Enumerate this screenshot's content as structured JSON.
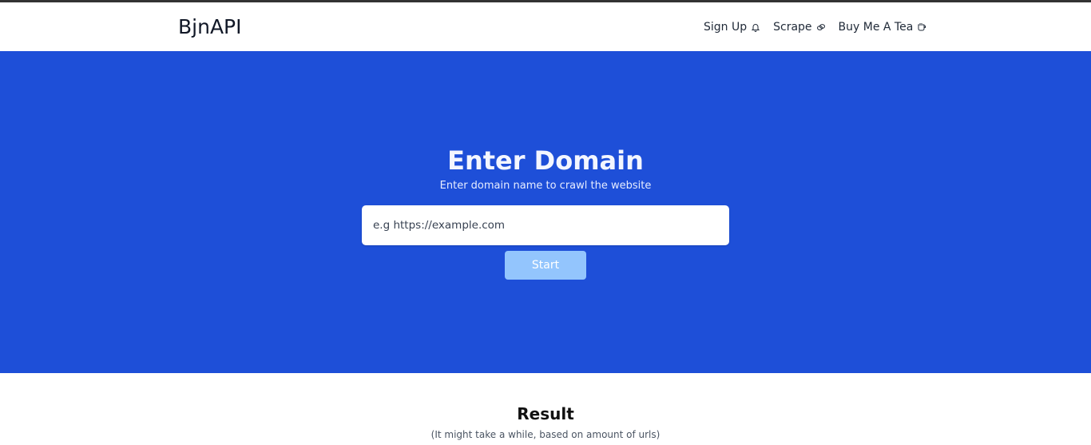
{
  "navbar": {
    "brand": "BjnAPI",
    "items": [
      {
        "label": "Sign Up",
        "icon": "bell-icon"
      },
      {
        "label": "Scrape",
        "icon": "link-icon"
      },
      {
        "label": "Buy Me A Tea",
        "icon": "cup-icon"
      }
    ]
  },
  "hero": {
    "title": "Enter Domain",
    "subtitle": "Enter domain name to crawl the website",
    "input_placeholder": "e.g https://example.com",
    "input_value": "",
    "start_label": "Start",
    "background_color": "#1e4fd8",
    "button_color": "#93c5fd"
  },
  "result": {
    "title": "Result",
    "note": "(It might take a while, based on amount of urls)"
  }
}
